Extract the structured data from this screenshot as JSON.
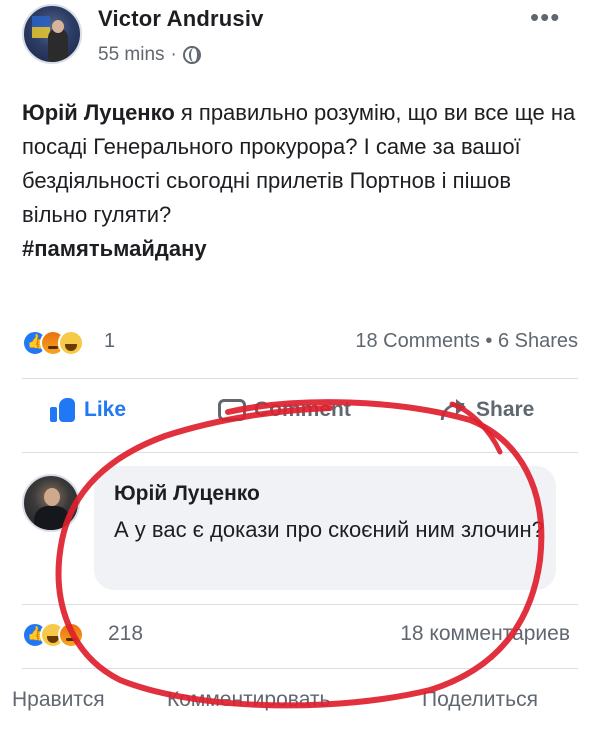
{
  "post": {
    "author": "Victor Andrusiv",
    "time": "55 mins",
    "meta_separator": "·",
    "more_label": "•••",
    "text_mention": "Юрій Луценко",
    "text_body": " я правильно розумію, що ви все ще на посаді Генерального прокурора? І саме за вашої бездіяльності сьогодні прилетів Портнов і пішов вільно гуляти?",
    "hashtag": "#памятьмайдану",
    "reaction_count": "1",
    "comments_shares": "18 Comments • 6 Shares",
    "actions": {
      "like": "Like",
      "comment": "Comment",
      "share": "Share"
    }
  },
  "comment": {
    "author": "Юрій Луценко",
    "text": "А у вас є докази про скоєний ним злочин?"
  },
  "comment_footer": {
    "reaction_count": "218",
    "comments_count": "18 комментариев",
    "actions": {
      "like": "Нравится",
      "comment": "Комментировать",
      "share": "Поделиться"
    }
  },
  "colors": {
    "facebook_blue": "#2078f4",
    "annotation_red": "#e0202e",
    "bubble_bg": "#f0f2f5",
    "meta_gray": "#606770"
  },
  "icons": {
    "reactions_post": [
      "like-reaction-icon",
      "angry-reaction-icon",
      "haha-reaction-icon"
    ],
    "reactions_comment": [
      "like-reaction-icon",
      "haha-reaction-icon",
      "angry-reaction-icon"
    ],
    "privacy": "globe-icon"
  }
}
